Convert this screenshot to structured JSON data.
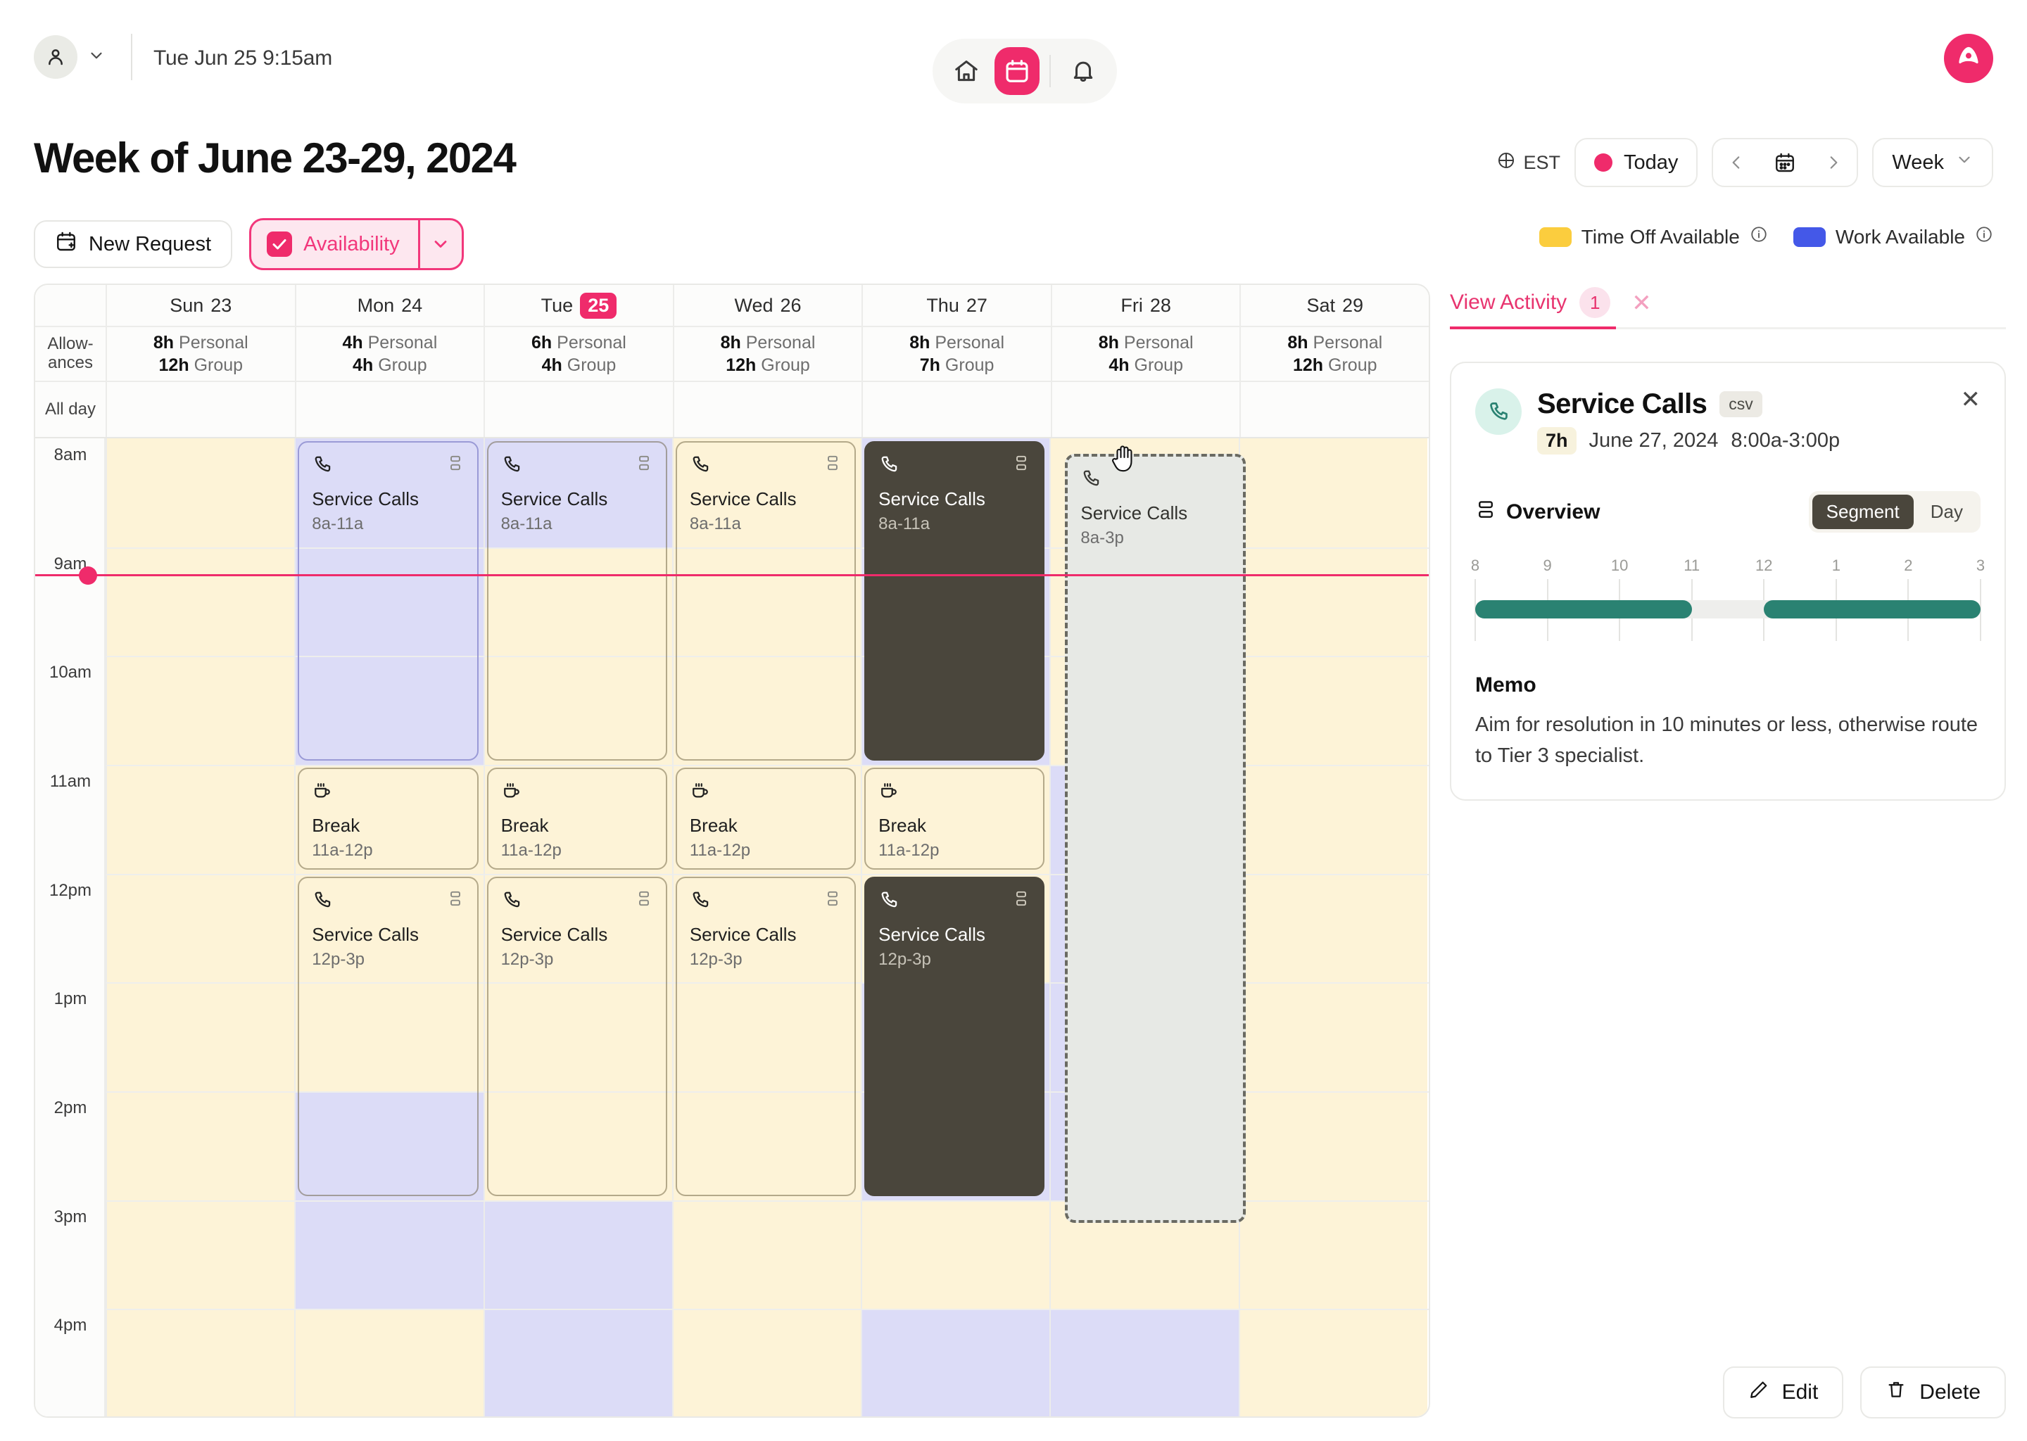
{
  "topbar": {
    "user_icon": "person-icon",
    "user_caret": "chevron-down-icon",
    "clock": "Tue Jun 25 9:15am",
    "nav": [
      {
        "name": "home",
        "icon": "home-icon",
        "active": false
      },
      {
        "name": "calendar",
        "icon": "calendar-icon",
        "active": true
      },
      {
        "name": "notifications",
        "icon": "bell-icon",
        "active": false
      }
    ],
    "account_avatar": "account-avatar-icon"
  },
  "page": {
    "title": "Week of June 23-29, 2024"
  },
  "toolbar": {
    "new_request_label": "New Request",
    "new_request_icon": "calendar-plus-icon",
    "availability_label": "Availability",
    "availability_icon": "checkbox-checked-icon",
    "availability_caret": "chevron-down-icon"
  },
  "header_controls": {
    "timezone": "EST",
    "timezone_icon": "globe-icon",
    "today_label": "Today",
    "prev_icon": "chevron-left-icon",
    "calendar_icon": "calendar-icon",
    "next_icon": "chevron-right-icon",
    "view_label": "Week",
    "view_caret": "chevron-down-icon"
  },
  "legend": [
    {
      "label": "Time Off Available",
      "color": "#fbcd3e",
      "info_icon": "info-icon"
    },
    {
      "label": "Work Available",
      "color": "#4458e8",
      "info_icon": "info-icon"
    }
  ],
  "calendar": {
    "gutter": {
      "allowances_label": "Allow-\nances",
      "allday_label": "All day"
    },
    "days": [
      {
        "dow": "Sun",
        "num": "23",
        "today": false,
        "personal": "8h",
        "group": "12h"
      },
      {
        "dow": "Mon",
        "num": "24",
        "today": false,
        "personal": "4h",
        "group": "4h"
      },
      {
        "dow": "Tue",
        "num": "25",
        "today": true,
        "personal": "6h",
        "group": "4h"
      },
      {
        "dow": "Wed",
        "num": "26",
        "today": false,
        "personal": "8h",
        "group": "12h"
      },
      {
        "dow": "Thu",
        "num": "27",
        "today": false,
        "personal": "8h",
        "group": "7h"
      },
      {
        "dow": "Fri",
        "num": "28",
        "today": false,
        "personal": "8h",
        "group": "4h"
      },
      {
        "dow": "Sat",
        "num": "29",
        "today": false,
        "personal": "8h",
        "group": "12h"
      }
    ],
    "allowance_personal_label": "Personal",
    "allowance_group_label": "Group",
    "hours": [
      "8am",
      "9am",
      "10am",
      "11am",
      "12pm",
      "1pm",
      "2pm",
      "3pm",
      "4pm"
    ],
    "now_time": "9:15am",
    "events": [
      {
        "day": 1,
        "title": "Service Calls",
        "time": "8a-11a",
        "icon": "phone-icon",
        "split_icon": "split-icon",
        "start": 8,
        "end": 11,
        "style": "blue"
      },
      {
        "day": 2,
        "title": "Service Calls",
        "time": "8a-11a",
        "icon": "phone-icon",
        "split_icon": "split-icon",
        "start": 8,
        "end": 11,
        "style": "plain"
      },
      {
        "day": 3,
        "title": "Service Calls",
        "time": "8a-11a",
        "icon": "phone-icon",
        "split_icon": "split-icon",
        "start": 8,
        "end": 11,
        "style": "plain"
      },
      {
        "day": 4,
        "title": "Service Calls",
        "time": "8a-11a",
        "icon": "phone-icon",
        "split_icon": "split-icon",
        "start": 8,
        "end": 11,
        "style": "dark"
      },
      {
        "day": 1,
        "title": "Break",
        "time": "11a-12p",
        "icon": "coffee-icon",
        "split_icon": "",
        "start": 11,
        "end": 12,
        "style": "plain"
      },
      {
        "day": 2,
        "title": "Break",
        "time": "11a-12p",
        "icon": "coffee-icon",
        "split_icon": "",
        "start": 11,
        "end": 12,
        "style": "plain"
      },
      {
        "day": 3,
        "title": "Break",
        "time": "11a-12p",
        "icon": "coffee-icon",
        "split_icon": "",
        "start": 11,
        "end": 12,
        "style": "plain"
      },
      {
        "day": 4,
        "title": "Break",
        "time": "11a-12p",
        "icon": "coffee-icon",
        "split_icon": "",
        "start": 11,
        "end": 12,
        "style": "plain"
      },
      {
        "day": 1,
        "title": "Service Calls",
        "time": "12p-3p",
        "icon": "phone-icon",
        "split_icon": "split-icon",
        "start": 12,
        "end": 15,
        "style": "plain"
      },
      {
        "day": 2,
        "title": "Service Calls",
        "time": "12p-3p",
        "icon": "phone-icon",
        "split_icon": "split-icon",
        "start": 12,
        "end": 15,
        "style": "plain"
      },
      {
        "day": 3,
        "title": "Service Calls",
        "time": "12p-3p",
        "icon": "phone-icon",
        "split_icon": "split-icon",
        "start": 12,
        "end": 15,
        "style": "plain"
      },
      {
        "day": 4,
        "title": "Service Calls",
        "time": "12p-3p",
        "icon": "phone-icon",
        "split_icon": "split-icon",
        "start": 12,
        "end": 15,
        "style": "dark"
      }
    ],
    "drag_ghost": {
      "title": "Service Calls",
      "time": "8a-3p",
      "icon": "phone-icon",
      "cursor": "grab-hand-cursor"
    }
  },
  "panel": {
    "tab_label": "View Activity",
    "tab_badge": "1",
    "tab_close_icon": "close-icon",
    "detail": {
      "icon": "phone-icon",
      "title": "Service Calls",
      "source_chip": "csv",
      "duration_chip": "7h",
      "date": "June 27, 2024",
      "time_range": "8:00a-3:00p",
      "close_icon": "close-icon",
      "overview_label": "Overview",
      "overview_icon": "layout-rows-icon",
      "toggle": {
        "options": [
          "Segment",
          "Day"
        ],
        "selected": "Segment"
      },
      "memo_label": "Memo",
      "memo_text": "Aim for resolution in 10 minutes or less, otherwise route to Tier 3 specialist."
    },
    "actions": [
      {
        "label": "Edit",
        "icon": "pencil-icon"
      },
      {
        "label": "Delete",
        "icon": "trash-icon"
      }
    ]
  },
  "chart_data": {
    "type": "timeline",
    "title": "Overview",
    "xlabel": "",
    "tick_labels": [
      "8",
      "9",
      "10",
      "11",
      "12",
      "1",
      "2",
      "3"
    ],
    "xlim": [
      8,
      15
    ],
    "track_color": "#eeeeec",
    "segment_color": "#2a8272",
    "segments": [
      {
        "start": 8,
        "end": 11,
        "label": "Service Calls"
      },
      {
        "start": 12,
        "end": 15,
        "label": "Service Calls"
      }
    ],
    "gaps": [
      {
        "start": 11,
        "end": 12,
        "label": "Break"
      }
    ]
  }
}
